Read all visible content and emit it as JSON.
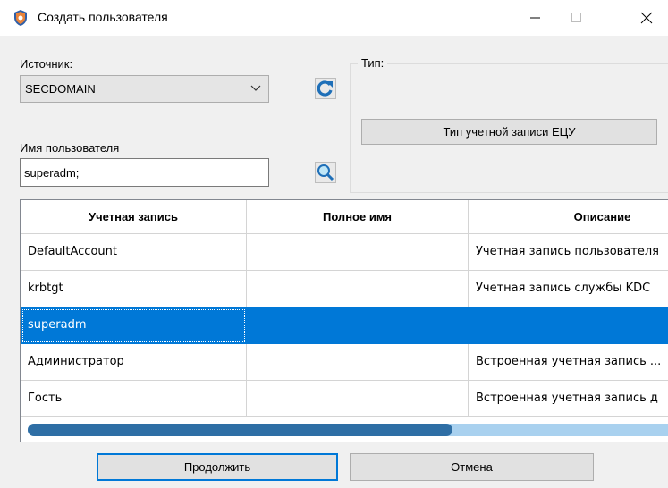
{
  "window": {
    "title": "Создать пользователя",
    "minimize": "—",
    "maximize": "☐",
    "close": "✕"
  },
  "source": {
    "label": "Источник:",
    "value": "SECDOMAIN"
  },
  "username": {
    "label": "Имя пользователя",
    "value": "superadm;"
  },
  "type_group": {
    "title": "Тип:",
    "button_label": "Тип учетной записи ЕЦУ"
  },
  "table": {
    "columns": [
      "Учетная запись",
      "Полное имя",
      "Описание"
    ],
    "rows": [
      {
        "account": "DefaultAccount",
        "full_name": "",
        "description": "Учетная запись пользователя"
      },
      {
        "account": "krbtgt",
        "full_name": "",
        "description": "Учетная запись службы KDC"
      },
      {
        "account": "superadm",
        "full_name": "",
        "description": ""
      },
      {
        "account": "Администратор",
        "full_name": "",
        "description": "Встроенная учетная запись ..."
      },
      {
        "account": "Гость",
        "full_name": "",
        "description": "Встроенная учетная запись д"
      }
    ],
    "selected_row": 2
  },
  "buttons": {
    "continue": "Продолжить",
    "cancel": "Отмена"
  },
  "colors": {
    "accent": "#0078d7",
    "refresh": "#1e6fb8"
  }
}
